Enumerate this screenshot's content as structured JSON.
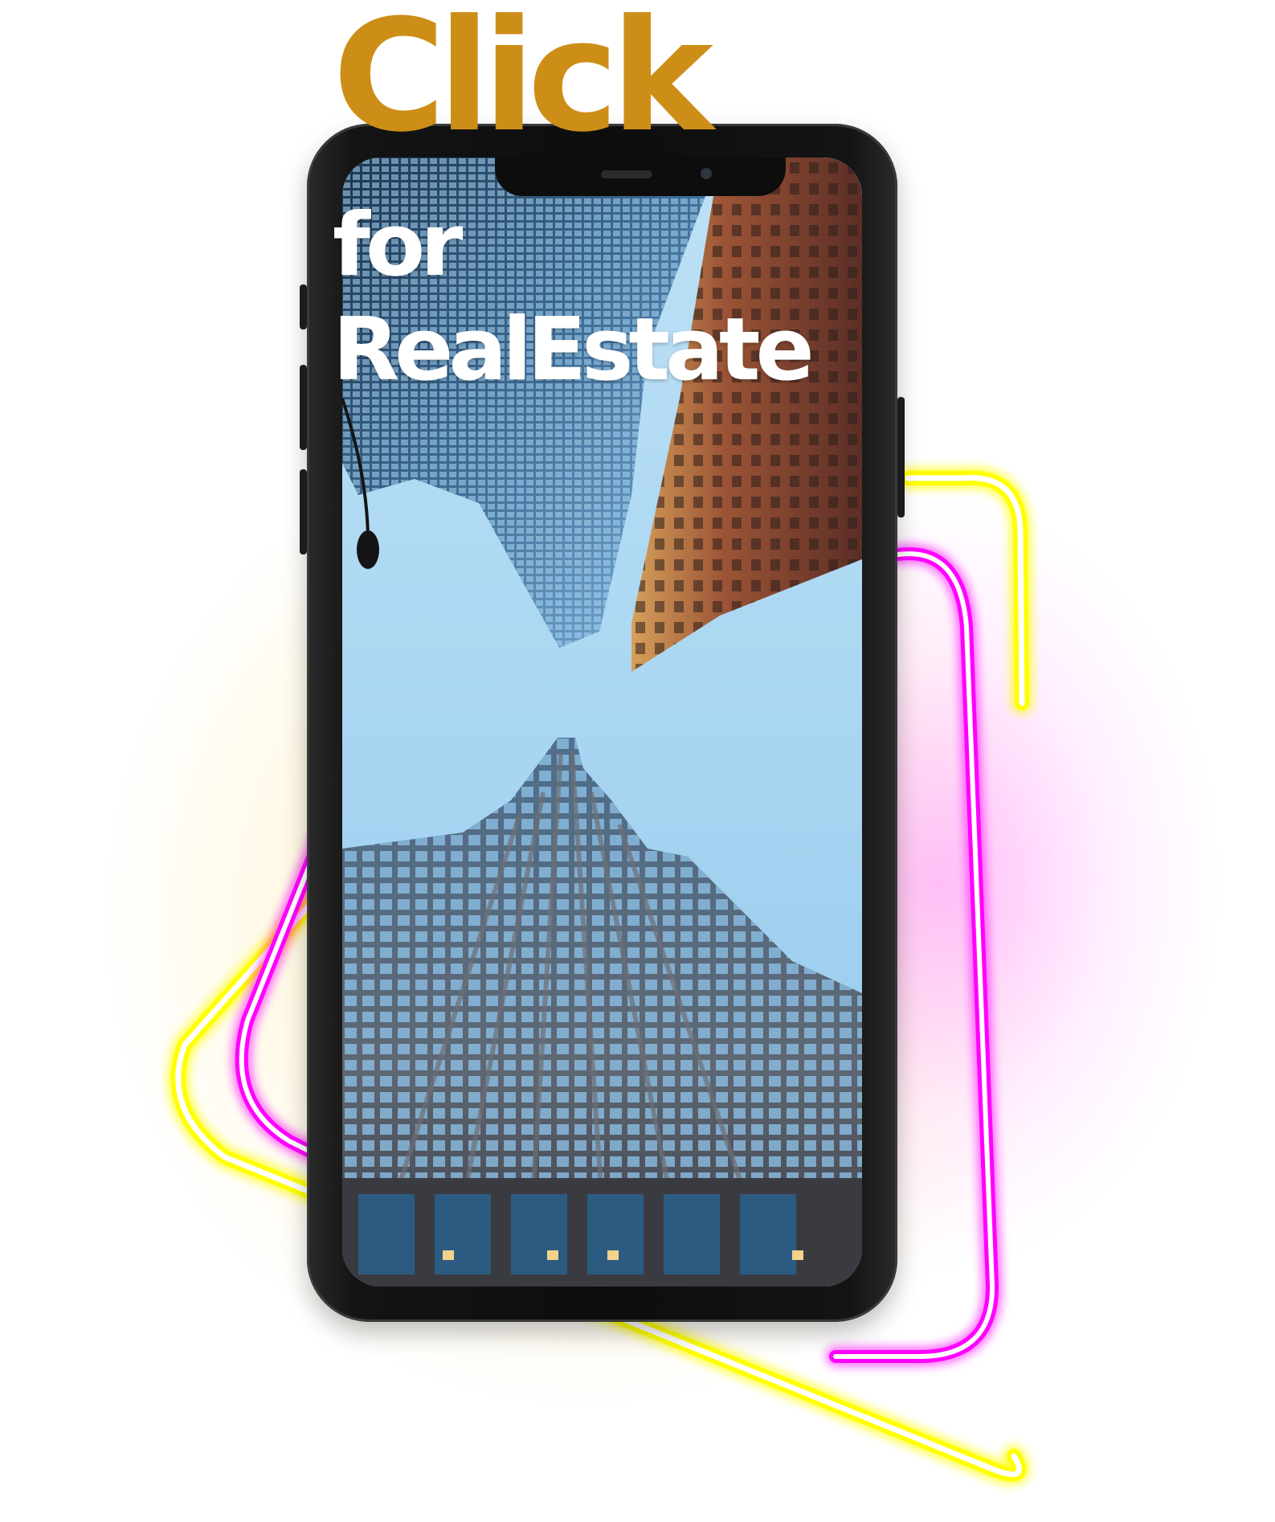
{
  "headline": {
    "line1": "Click",
    "line2": "for",
    "line3": "RealEstate"
  },
  "colors": {
    "headline_accent": "#cd8e18",
    "headline_secondary": "#ffffff",
    "neon_yellow": "#ffff00",
    "neon_magenta": "#ff00ff",
    "sky": "#a5d3f0",
    "phone_frame": "#111111"
  },
  "illustration": {
    "device": "smartphone",
    "screen_content": "skyscrapers-viewed-from-below"
  }
}
